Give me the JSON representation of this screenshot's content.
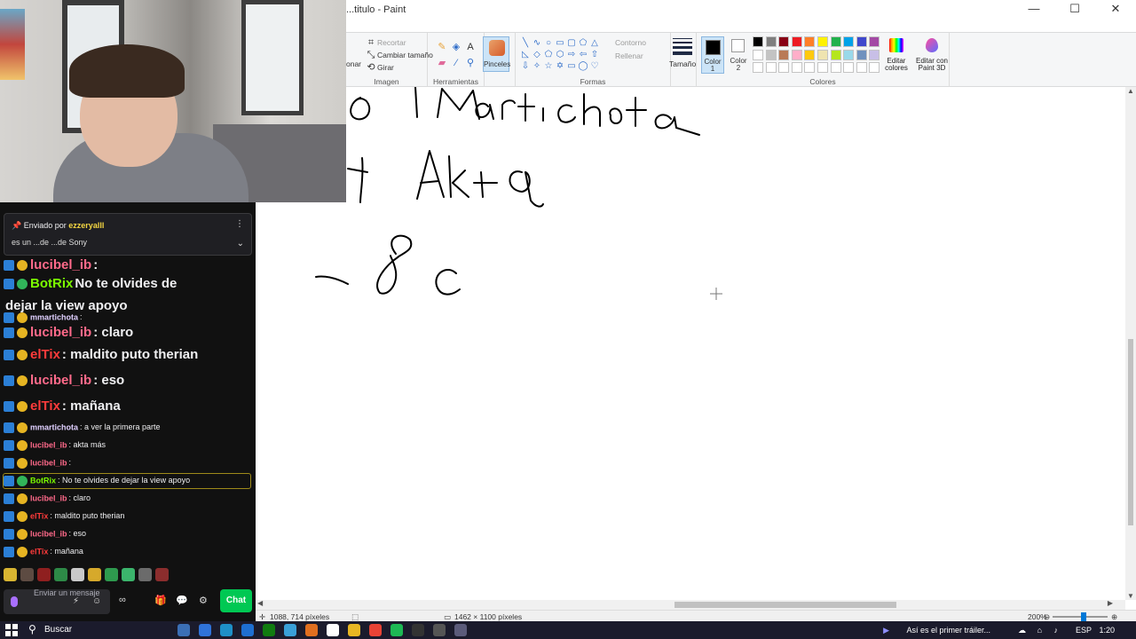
{
  "paint": {
    "window_title": "...titulo - Paint",
    "controls": {
      "minimize": "—",
      "maximize": "☐",
      "close": "✕"
    },
    "ribbon": {
      "image": {
        "crop": "Recortar",
        "resize": "Cambiar tamaño",
        "rotate": "Girar",
        "select_partial": "onar",
        "label": "Imagen"
      },
      "tools": {
        "label": "Herramientas"
      },
      "brushes": {
        "label": "Pinceles"
      },
      "shapes": {
        "outline": "Contorno",
        "fill": "Rellenar",
        "label": "Formas"
      },
      "size": {
        "label": "Tamaño"
      },
      "color1": {
        "label_line1": "Color",
        "label_line2": "1"
      },
      "color2": {
        "label_line1": "Color",
        "label_line2": "2"
      },
      "colors": {
        "label": "Colores",
        "palette": [
          "#000000",
          "#7f7f7f",
          "#880015",
          "#ed1c24",
          "#ff7f27",
          "#fff200",
          "#22b14c",
          "#00a2e8",
          "#3f48cc",
          "#a349a4",
          "#ffffff",
          "#c3c3c3",
          "#b97a57",
          "#ffaec9",
          "#ffc90e",
          "#efe4b0",
          "#b5e61d",
          "#99d9ea",
          "#7092be",
          "#c8bfe7",
          "#ffffff",
          "#ffffff",
          "#ffffff",
          "#ffffff",
          "#ffffff",
          "#ffffff",
          "#ffffff",
          "#ffffff",
          "#ffffff",
          "#ffffff"
        ]
      },
      "edit_colors": {
        "line1": "Editar",
        "line2": "colores"
      },
      "paint3d": {
        "line1": "Editar con",
        "line2": "Paint 3D"
      }
    },
    "status": {
      "cursor_pos": "1088, 714 píxeles",
      "canvas_size": "1462 × 1100 píxeles",
      "zoom": "200%"
    }
  },
  "chat": {
    "pinned": {
      "sent_by": "Enviado por",
      "user": "ezzeryalll",
      "text": "es un ...de ...de Sony"
    },
    "messages": [
      {
        "user": "lucibel_ib",
        "text": ":",
        "color": "#ff6a8a",
        "size": "big"
      },
      {
        "user": "BotRix",
        "text": "No te olvides de",
        "color": "#7cfc00",
        "size": "big"
      },
      {
        "user": "",
        "text": "dejar la view apoyo",
        "color": "#ffffff",
        "size": "big"
      },
      {
        "user": "mmartichota",
        "text": ":",
        "color": "#e0d0ff",
        "size": "small"
      },
      {
        "user": "lucibel_ib",
        "text": ": claro",
        "color": "#ff6a8a",
        "size": "big"
      },
      {
        "user": "elTix",
        "text": ": maldito puto therian",
        "color": "#ff3b3b",
        "size": "big"
      },
      {
        "user": "lucibel_ib",
        "text": ": eso",
        "color": "#ff6a8a",
        "size": "big"
      },
      {
        "user": "elTix",
        "text": ": mañana",
        "color": "#ff3b3b",
        "size": "big"
      },
      {
        "user": "mmartichota",
        "text": ": a ver la primera parte",
        "color": "#e0d0ff",
        "size": "small"
      },
      {
        "user": "lucibel_ib",
        "text": ": akta más",
        "color": "#ff6a8a",
        "size": "small"
      },
      {
        "user": "lucibel_ib",
        "text": ":",
        "color": "#ff6a8a",
        "size": "small"
      },
      {
        "user": "BotRix",
        "text": ": No te olvides de dejar la view apoyo",
        "color": "#7cfc00",
        "size": "small"
      },
      {
        "user": "lucibel_ib",
        "text": ": claro",
        "color": "#ff6a8a",
        "size": "small"
      },
      {
        "user": "elTix",
        "text": ": maldito puto therian",
        "color": "#ff3b3b",
        "size": "small"
      },
      {
        "user": "lucibel_ib",
        "text": ": eso",
        "color": "#ff6a8a",
        "size": "small"
      },
      {
        "user": "elTix",
        "text": ": mañana",
        "color": "#ff3b3b",
        "size": "small"
      }
    ],
    "input_placeholder": "Enviar un mensaje",
    "send_label": "Chat"
  },
  "taskbar": {
    "search": "Buscar",
    "notification": "Así es el primer tráiler...",
    "lang": "ESP",
    "time": "1:20"
  }
}
